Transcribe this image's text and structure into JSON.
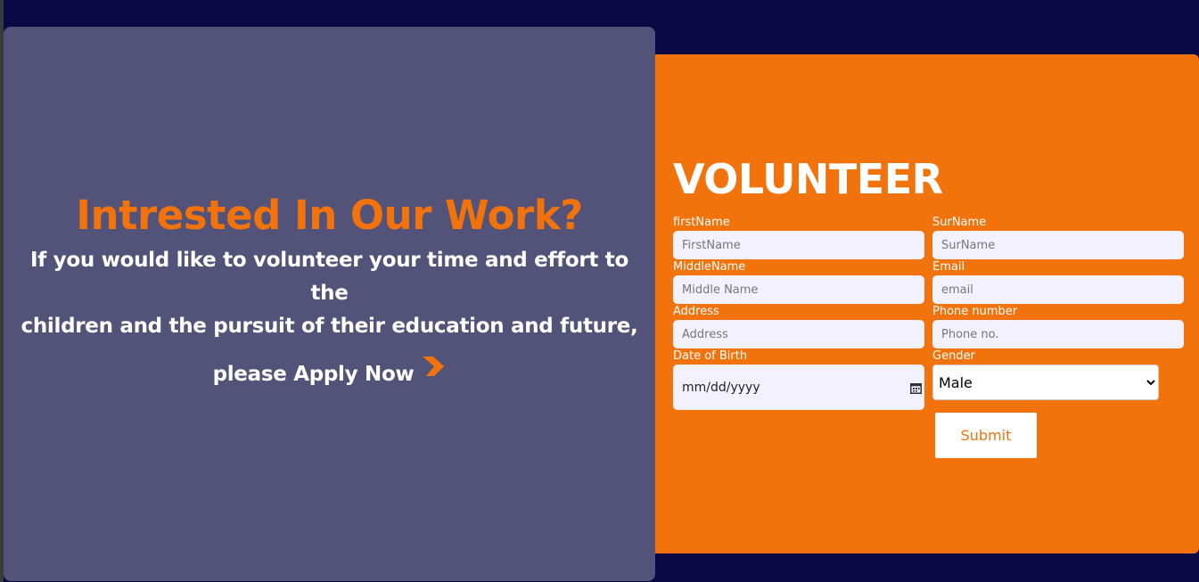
{
  "left": {
    "headline": "Intrested In Our Work?",
    "subtext_line1": "If you would like to volunteer your time and effort to the",
    "subtext_line2": "children and the pursuit of their education and future,",
    "apply_text": "please Apply Now",
    "chevron_icon": "chevron-right-icon"
  },
  "form": {
    "title": "VOLUNTEER",
    "first_name": {
      "label": "firstName",
      "placeholder": "FirstName"
    },
    "surname": {
      "label": "SurName",
      "placeholder": "SurName"
    },
    "middle_name": {
      "label": "MiddleName",
      "placeholder": "Middle Name"
    },
    "email": {
      "label": "Email",
      "placeholder": "email"
    },
    "address": {
      "label": "Address",
      "placeholder": "Address"
    },
    "phone": {
      "label": "Phone number",
      "placeholder": "Phone no."
    },
    "dob": {
      "label": "Date of Birth",
      "value": "mm/dd/yyyy",
      "icon": "calendar-icon"
    },
    "gender": {
      "label": "Gender",
      "selected": "Male"
    },
    "submit_label": "Submit"
  },
  "colors": {
    "background": "#0a0845",
    "left_card": "#53537a",
    "accent_orange": "#f2720c",
    "input_bg": "#f3f1fd",
    "white": "#ffffff"
  }
}
